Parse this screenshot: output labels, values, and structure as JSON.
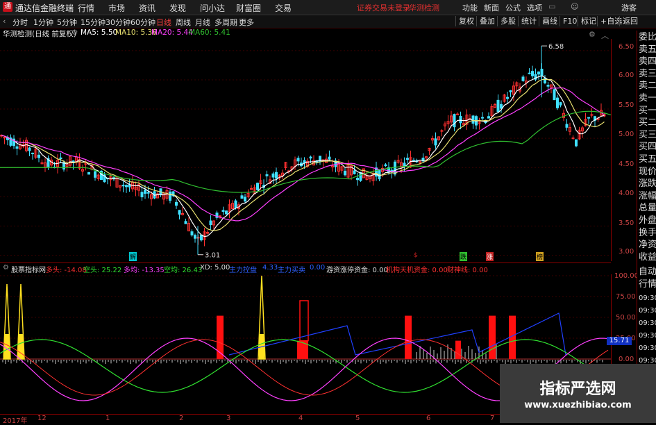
{
  "titlebar": {
    "logo": "通",
    "app_title": "通达信金融终端",
    "menus": [
      "行情",
      "市场",
      "资讯",
      "发现",
      "问小达",
      "财富圈",
      "交易"
    ],
    "warning": "证券交易未登录",
    "warning2": "华测检测",
    "right_menus": [
      "功能",
      "新面",
      "公式",
      "选项"
    ],
    "guest": "游客"
  },
  "toolbar": {
    "periods": [
      "分时",
      "1分钟",
      "5分钟",
      "15分钟",
      "30分钟",
      "60分钟",
      "日线",
      "周线",
      "月线",
      "多周期",
      "更多"
    ],
    "active_period": "日线",
    "right_buttons": [
      "复权",
      "叠加",
      "多股",
      "统计",
      "画线",
      "F10",
      "标记",
      "+自选",
      "返回"
    ]
  },
  "main_chart": {
    "stock_label": "华测检测(日线 前复权)",
    "ma5": "MA5: 5.50",
    "ma10": "MA10: 5.36",
    "ma20": "MA20: 5.44",
    "ma60": "MA60: 5.41",
    "high_label": "6.58",
    "low_label": "3.01",
    "y_ticks": [
      "6.50",
      "6.00",
      "5.50",
      "5.00",
      "4.50",
      "4.00",
      "3.50",
      "3.00"
    ],
    "markers": [
      "解",
      "跌",
      "涨",
      "榜"
    ],
    "colors": {
      "up": "#ff3030",
      "down": "#40e0ff",
      "ma5": "#ffffff",
      "ma10": "#e8e070",
      "ma20": "#ff40ff",
      "ma60": "#30c030"
    }
  },
  "chart_data": {
    "type": "line",
    "title": "华测检测(日线 前复权)",
    "x": [
      "2017-12",
      "2018-01",
      "2018-02",
      "2018-03",
      "2018-04",
      "2018-05",
      "2018-06",
      "2018-07"
    ],
    "series": [
      {
        "name": "MA5",
        "values": [
          5.0,
          4.7,
          4.1,
          4.4,
          4.6,
          4.6,
          5.6,
          5.5
        ]
      },
      {
        "name": "MA60",
        "values": [
          4.5,
          4.5,
          4.3,
          4.1,
          4.3,
          4.5,
          4.9,
          5.4
        ]
      }
    ],
    "ylim": [
      3.0,
      6.6
    ],
    "high": 6.58,
    "low": 3.01
  },
  "indicator": {
    "name": "股票指标网",
    "items": [
      {
        "label": "多头: -14.08",
        "color": "#ff3030"
      },
      {
        "label": "空头: 25.22",
        "color": "#30e030"
      },
      {
        "label": "多均: -13.35",
        "color": "#ff40ff"
      },
      {
        "label": "空均: 26.43",
        "color": "#30e030"
      },
      {
        "label": "XD: 5.00",
        "color": "#dddddd"
      },
      {
        "label": "主力控盘",
        "color": "#3060ff"
      },
      {
        "label": "4.33",
        "color": "#3060ff"
      },
      {
        "label": "主力买卖",
        "color": "#3060ff"
      },
      {
        "label": "0.00",
        "color": "#3060ff"
      },
      {
        "label": "游资涨停资金: 0.00",
        "color": "#dddddd"
      },
      {
        "label": "机构天机资金: 0.00",
        "color": "#ff3030"
      },
      {
        "label": "财神线: 0.00",
        "color": "#ff3030"
      }
    ],
    "y_ticks": [
      "100.00",
      "75.00",
      "50.00",
      "25.00",
      "0.00"
    ],
    "value_box": "15.71"
  },
  "right_panel": {
    "items": [
      "委比",
      "卖五",
      "卖四",
      "卖三",
      "卖二",
      "卖一",
      "买一",
      "买二",
      "买三",
      "买四",
      "买五",
      "现价",
      "涨跌",
      "涨幅",
      "总量",
      "外盘",
      "换手",
      "净资",
      "收益"
    ],
    "items2": [
      "自动",
      "行情"
    ],
    "times": [
      "09:30",
      "09:30",
      "09:30",
      "09:30",
      "09:30",
      "09:30",
      "09:30",
      "09:30"
    ]
  },
  "bottom_axis": {
    "labels": [
      "2017年",
      "12",
      "1",
      "2",
      "3",
      "4",
      "5",
      "6",
      "7"
    ]
  },
  "watermark": {
    "line1": "指标严选网",
    "line2": "www.xuezhibiao.com"
  }
}
